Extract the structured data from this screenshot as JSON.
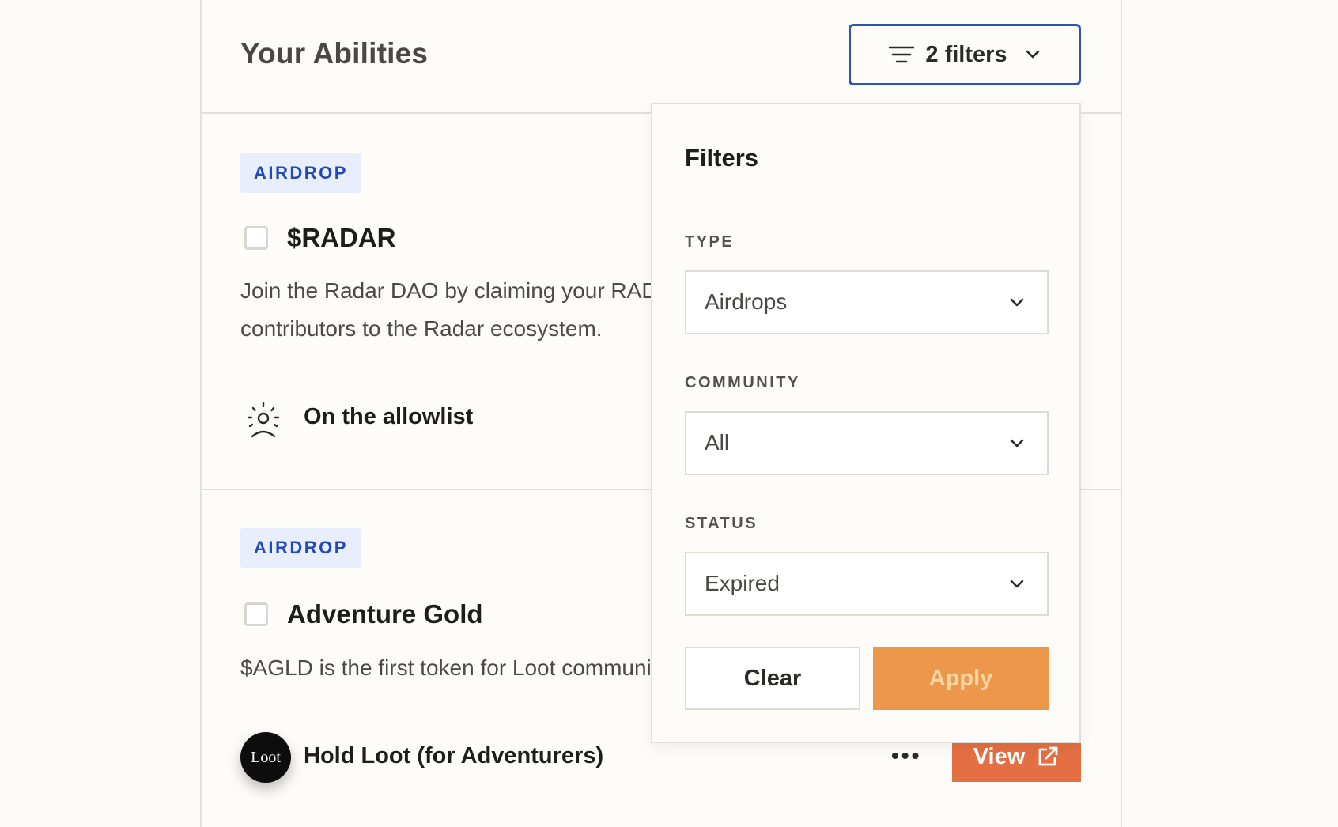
{
  "header": {
    "title": "Your Abilities",
    "filter_button_label": "2 filters"
  },
  "cards": [
    {
      "badge": "AIRDROP",
      "title": "$RADAR",
      "description_line1": "Join the Radar DAO by claiming your RADAR",
      "description_line2": "contributors to the Radar ecosystem.",
      "requirement": "On the allowlist"
    },
    {
      "badge": "AIRDROP",
      "title": "Adventure Gold",
      "description_line1": "$AGLD is the first token for Loot community",
      "requirement": "Hold Loot (for Adventurers)",
      "avatar_text": "Loot",
      "more_label": "•••",
      "view_label": "View"
    }
  ],
  "filters": {
    "title": "Filters",
    "type_label": "TYPE",
    "type_value": "Airdrops",
    "community_label": "COMMUNITY",
    "community_value": "All",
    "status_label": "STATUS",
    "status_value": "Expired",
    "clear_label": "Clear",
    "apply_label": "Apply"
  },
  "colors": {
    "accent_blue": "#2c55b5",
    "badge_bg": "#e8eefb",
    "badge_text": "#2348b8",
    "view_button": "#e46f42",
    "apply_button": "#ec974a"
  }
}
